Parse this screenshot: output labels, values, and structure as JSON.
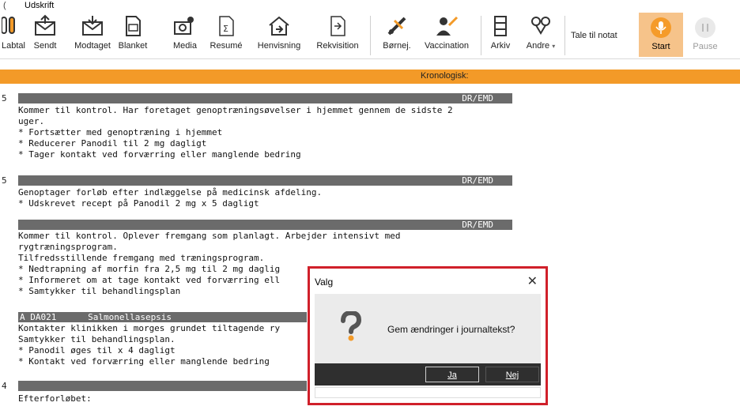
{
  "menubar": {
    "tick": "(",
    "label": "Udskrift"
  },
  "toolbar": {
    "buttons": [
      {
        "label": "Labtal",
        "icon": "lab-tubes-icon"
      },
      {
        "label": "Sendt",
        "icon": "send-mail-icon"
      },
      {
        "label": "Modtaget",
        "icon": "receive-mail-icon"
      },
      {
        "label": "Blanket",
        "icon": "form-icon"
      },
      {
        "label": "Media",
        "icon": "camera-icon"
      },
      {
        "label": "Resumé",
        "icon": "summary-icon"
      },
      {
        "label": "Henvisning",
        "icon": "referral-icon"
      },
      {
        "label": "Rekvisition",
        "icon": "requisition-icon"
      },
      {
        "label": "Børnej.",
        "icon": "child-exam-icon"
      },
      {
        "label": "Vaccination",
        "icon": "vaccination-icon"
      },
      {
        "label": "Arkiv",
        "icon": "archive-icon"
      },
      {
        "label": "Andre",
        "icon": "other-icon",
        "dropdown": "▾"
      }
    ],
    "tale_label": "Tale til notat",
    "start_label": "Start",
    "pause_label": "Pause",
    "accent": "#f39a28"
  },
  "header": {
    "label": "Kronologisk:"
  },
  "entries": [
    {
      "gutter": "5",
      "tag": "DR/EMD",
      "label": "",
      "lines": [
        "Kommer til kontrol. Har foretaget genoptræningsøvelser i hjemmet gennem de sidste 2",
        "uger.",
        "* Fortsætter med genoptræning i hjemmet",
        "* Reducerer Panodil til 2 mg dagligt",
        "* Tager kontakt ved forværring eller manglende bedring"
      ]
    },
    {
      "gutter": "5",
      "tag": "DR/EMD",
      "label": "",
      "lines": [
        "Genoptager forløb efter indlæggelse på medicinsk afdeling.",
        "* Udskrevet recept på Panodil 2 mg x 5 dagligt"
      ]
    },
    {
      "gutter": "",
      "tag": "DR/EMD",
      "label": "",
      "lines": [
        "Kommer til kontrol. Oplever fremgang som planlagt. Arbejder intensivt med",
        "rygtræningsprogram.",
        "Tilfredsstillende fremgang med træningsprogram.",
        "* Nedtrapning af morfin fra 2,5 mg til 2 mg daglig",
        "* Informeret om at tage kontakt ved forværring ell",
        "* Samtykker til behandlingsplan"
      ]
    },
    {
      "gutter": "",
      "tag": "",
      "label": "A DA021      Salmonellasepsis",
      "lines": [
        "Kontakter klinikken i morges grundet tiltagende ry",
        "Samtykker til behandlingsplan.",
        "* Panodil øges til x 4 dagligt",
        "* Kontakt ved forværring eller manglende bedring"
      ]
    },
    {
      "gutter": "4",
      "tag": "",
      "label": "",
      "lines": [
        "Efterforløbet:"
      ]
    }
  ],
  "dialog": {
    "title": "Valg",
    "close": "✕",
    "icon": "question-icon",
    "message": "Gem ændringer i journaltekst?",
    "yes_label": "Ja",
    "no_label": "Nej",
    "border_color": "#d0202a"
  }
}
